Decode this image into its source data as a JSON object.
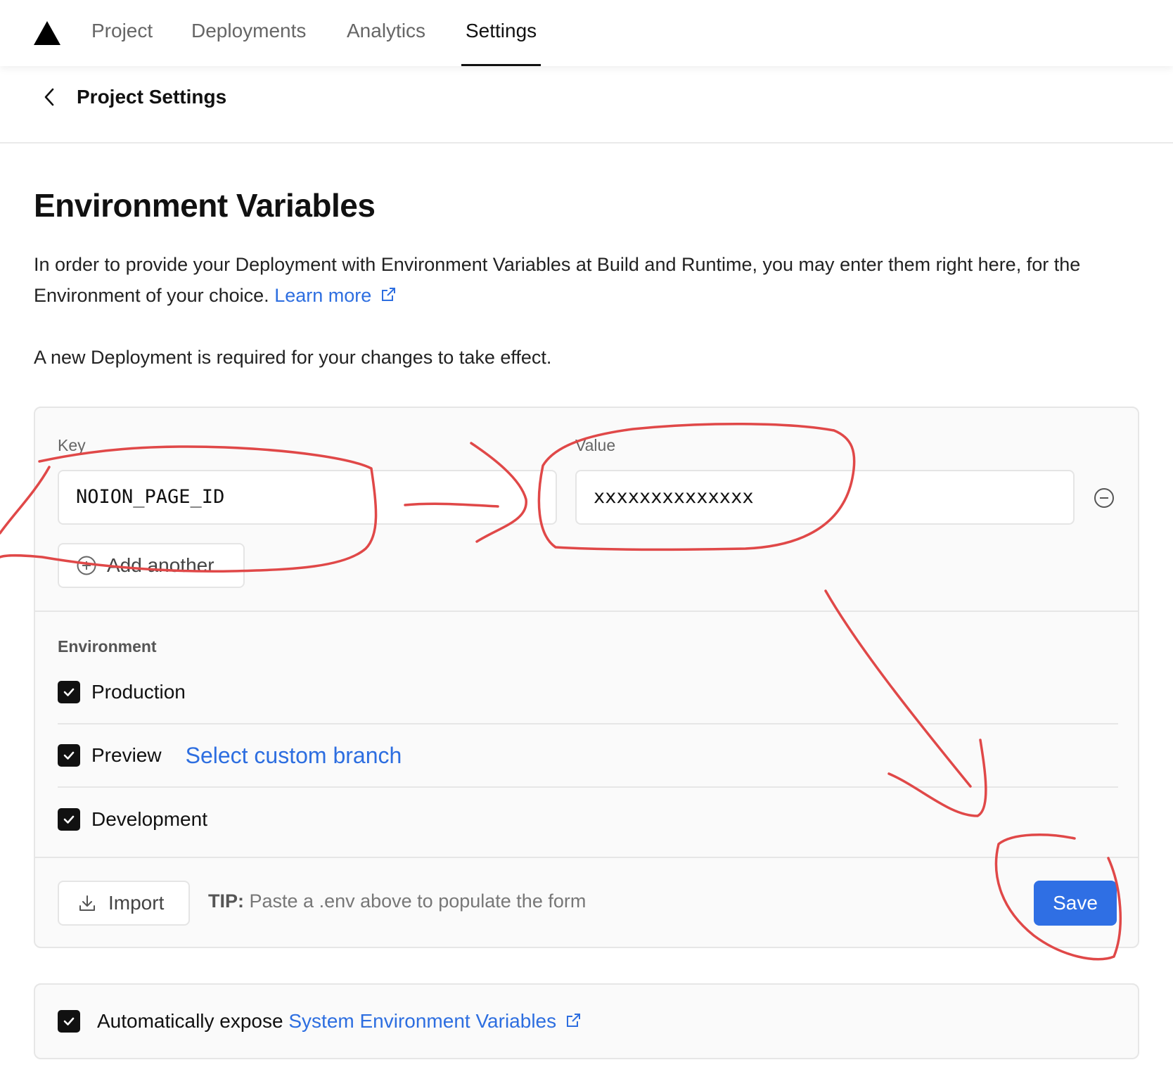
{
  "nav": {
    "tabs": [
      {
        "label": "Project"
      },
      {
        "label": "Deployments"
      },
      {
        "label": "Analytics"
      },
      {
        "label": "Settings",
        "active": true
      }
    ]
  },
  "header": {
    "title": "Project Settings"
  },
  "main": {
    "title": "Environment Variables",
    "description": "In order to provide your Deployment with Environment Variables at Build and Runtime, you may enter them right here, for the Environment of your choice.",
    "learn_more": "Learn more",
    "notice": "A new Deployment is required for your changes to take effect."
  },
  "form": {
    "key_label": "Key",
    "key_value": "NOION_PAGE_ID",
    "value_label": "Value",
    "value_value": "xxxxxxxxxxxxxx",
    "add_another": "Add another",
    "environment_heading": "Environment",
    "environments": [
      {
        "label": "Production",
        "checked": true
      },
      {
        "label": "Preview",
        "checked": true,
        "link": "Select custom branch"
      },
      {
        "label": "Development",
        "checked": true
      }
    ],
    "import_label": "Import",
    "tip_label": "TIP:",
    "tip_text": "Paste a .env above to populate the form",
    "save_label": "Save"
  },
  "system_vars": {
    "prefix": "Automatically expose",
    "link": "System Environment Variables",
    "checked": true
  },
  "colors": {
    "accent": "#2f6fe4",
    "link": "#2d6ee0",
    "annotation": "#e04848"
  },
  "icons": [
    "vercel-logo",
    "chevron-left-icon",
    "external-link-icon",
    "minus-circle-icon",
    "plus-circle-icon",
    "check-icon",
    "download-icon"
  ]
}
